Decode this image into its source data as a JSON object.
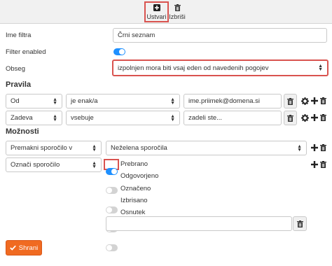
{
  "toolbar": {
    "create_label": "Ustvari",
    "delete_label": "Izbriši"
  },
  "form": {
    "filter_name_label": "Ime filtra",
    "filter_name_value": "Črni seznam",
    "filter_enabled_label": "Filter enabled",
    "filter_enabled": true,
    "scope_label": "Obseg",
    "scope_value": "izpolnjen mora biti vsaj eden od navedenih pogojev"
  },
  "rules": {
    "heading": "Pravila",
    "rows": [
      {
        "field": "Od",
        "operator": "je enak/a",
        "value": "ime.priimek@domena.si"
      },
      {
        "field": "Zadeva",
        "operator": "vsebuje",
        "value": "zadeli ste..."
      }
    ]
  },
  "actions": {
    "heading": "Možnosti",
    "rows": [
      {
        "action": "Premakni sporočilo v",
        "target": "Neželena sporočila"
      },
      {
        "action": "Označi sporočilo"
      }
    ],
    "flags": [
      {
        "label": "Prebrano",
        "on": true
      },
      {
        "label": "Odgovorjeno",
        "on": false
      },
      {
        "label": "Označeno",
        "on": false
      },
      {
        "label": "Izbrisano",
        "on": false
      },
      {
        "label": "Osnutek",
        "on": false
      }
    ]
  },
  "save_label": "Shrani",
  "colors": {
    "accent": "#1e90ff",
    "save": "#f06a21",
    "highlight": "#d9534f"
  }
}
